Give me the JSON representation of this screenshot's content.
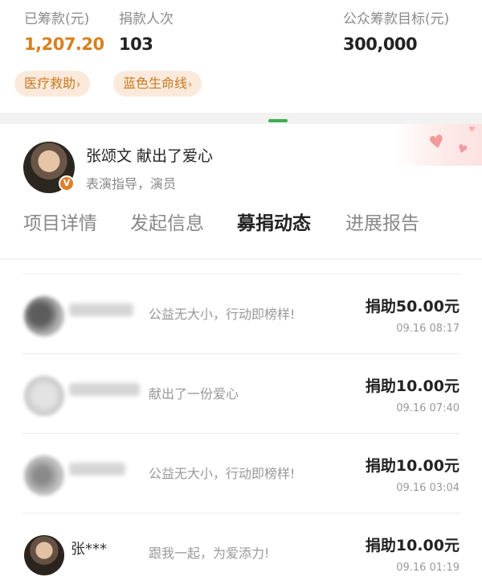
{
  "stats": {
    "raised": {
      "label": "已筹款(元)",
      "value": "1,207.20"
    },
    "donors": {
      "label": "捐款人次",
      "value": "103"
    },
    "goal": {
      "label": "公众筹款目标(元)",
      "value": "300,000"
    }
  },
  "tags": [
    {
      "label": "医疗救助",
      "icon": "chevron-right-icon"
    },
    {
      "label": "蓝色生命线",
      "icon": "chevron-right-icon"
    }
  ],
  "endorser": {
    "name": "张颂文 献出了爱心",
    "title": "表演指导，演员",
    "badge": "V"
  },
  "tabs": [
    "项目详情",
    "发起信息",
    "募捐动态",
    "进展报告"
  ],
  "active_tab_index": 2,
  "donations": [
    {
      "name": "",
      "message": "公益无大小，行动即榜样!",
      "amount": "捐助50.00元",
      "time": "09.16 08:17"
    },
    {
      "name": "",
      "message": "献出了一份爱心",
      "amount": "捐助10.00元",
      "time": "09.16 07:40"
    },
    {
      "name": "",
      "message": "公益无大小，行动即榜样!",
      "amount": "捐助10.00元",
      "time": "09.16 03:04"
    },
    {
      "name": "张***",
      "message": "跟我一起，为爱添力!",
      "amount": "捐助10.00元",
      "time": "09.16 01:19"
    }
  ],
  "colors": {
    "raised_value": "#d97f1e",
    "tag_bg": "#fbeadc",
    "tag_text": "#c9781f",
    "tab_indicator": "#3fae52",
    "badge": "#e0802a"
  }
}
